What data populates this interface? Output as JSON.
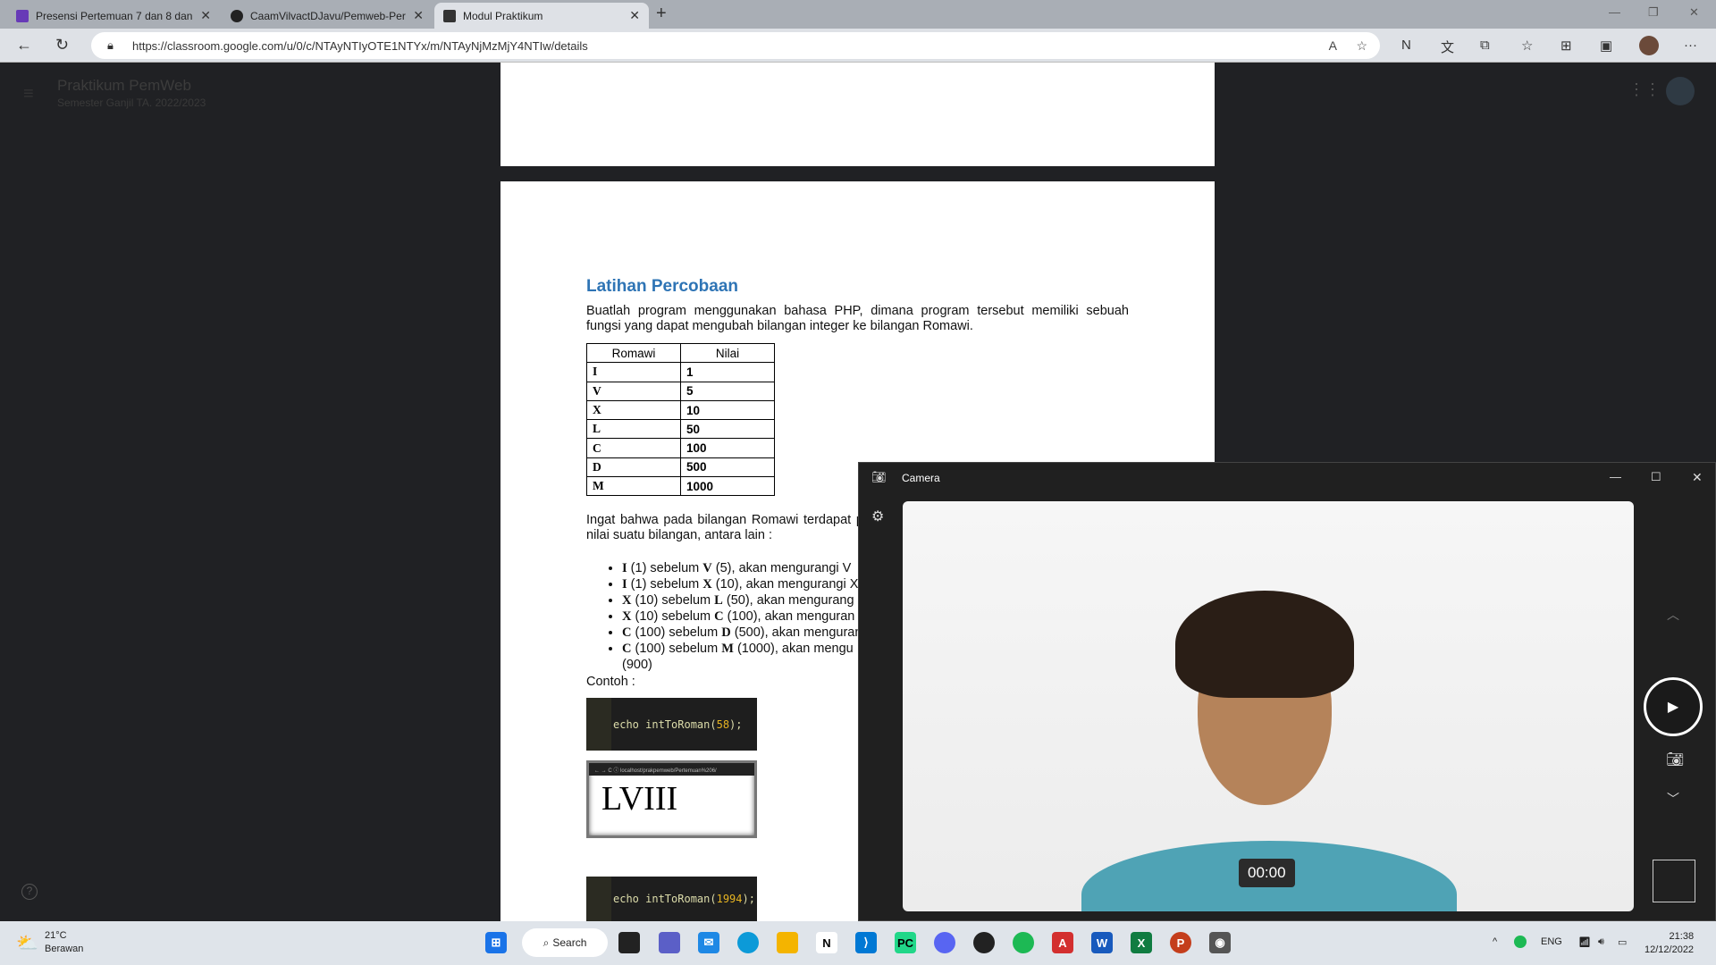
{
  "browser": {
    "tabs": [
      {
        "label": "Presensi Pertemuan 7 dan 8 dan",
        "color": "#673ab7"
      },
      {
        "label": "CaamVilvactDJavu/Pemweb-Pert",
        "color": "#222222"
      },
      {
        "label": "Modul Praktikum",
        "color": "#333333"
      }
    ],
    "url": "https://classroom.google.com/u/0/c/NTAyNTIyOTE1NTYx/m/NTAyNjMzMjY4NTIw/details"
  },
  "classroom": {
    "title": "Praktikum PemWeb",
    "subtitle": "Semester Ganjil TA. 2022/2023"
  },
  "doc": {
    "heading": "Latihan Percobaan",
    "intro": "Buatlah program menggunakan bahasa PHP, dimana program tersebut memiliki sebuah fungsi yang dapat mengubah bilangan integer ke bilangan Romawi.",
    "table_headers": [
      "Romawi",
      "Nilai"
    ],
    "table_rows": [
      [
        "I",
        "1"
      ],
      [
        "V",
        "5"
      ],
      [
        "X",
        "10"
      ],
      [
        "L",
        "50"
      ],
      [
        "C",
        "100"
      ],
      [
        "D",
        "500"
      ],
      [
        "M",
        "1000"
      ]
    ],
    "note": "Ingat bahwa pada bilangan Romawi terdapat p nilai suatu bilangan, antara lain :",
    "bullets": [
      {
        "a": "I",
        "b": " (1) sebelum ",
        "c": "V",
        "d": " (5), akan mengurangi V"
      },
      {
        "a": "I",
        "b": " (1) sebelum ",
        "c": "X",
        "d": " (10), akan mengurangi X"
      },
      {
        "a": "X",
        "b": " (10) sebelum ",
        "c": "L",
        "d": " (50), akan mengurang"
      },
      {
        "a": "X",
        "b": " (10) sebelum ",
        "c": "C",
        "d": " (100), akan menguran"
      },
      {
        "a": "C",
        "b": " (100) sebelum ",
        "c": "D",
        "d": " (500), akan menguran"
      },
      {
        "a": "C",
        "b": " (100) sebelum ",
        "c": "M",
        "d": " (1000), akan mengu (900)"
      }
    ],
    "example_label": "Contoh :",
    "code1_fn": "echo intToRoman(",
    "code1_arg": "58",
    "code1_end": ");",
    "shot_url": "← → C  ⓘ localhost/prakpemweb/Pertemuan%206/",
    "shot_result": "LVIII",
    "code2_fn": "echo intToRoman(",
    "code2_arg": "1994",
    "code2_end": ");"
  },
  "camera": {
    "title": "Camera",
    "timer": "00:00"
  },
  "taskbar": {
    "temp": "21°C",
    "weather": "Berawan",
    "search": "Search",
    "lang": "ENG",
    "time": "21:38",
    "date": "12/12/2022"
  }
}
